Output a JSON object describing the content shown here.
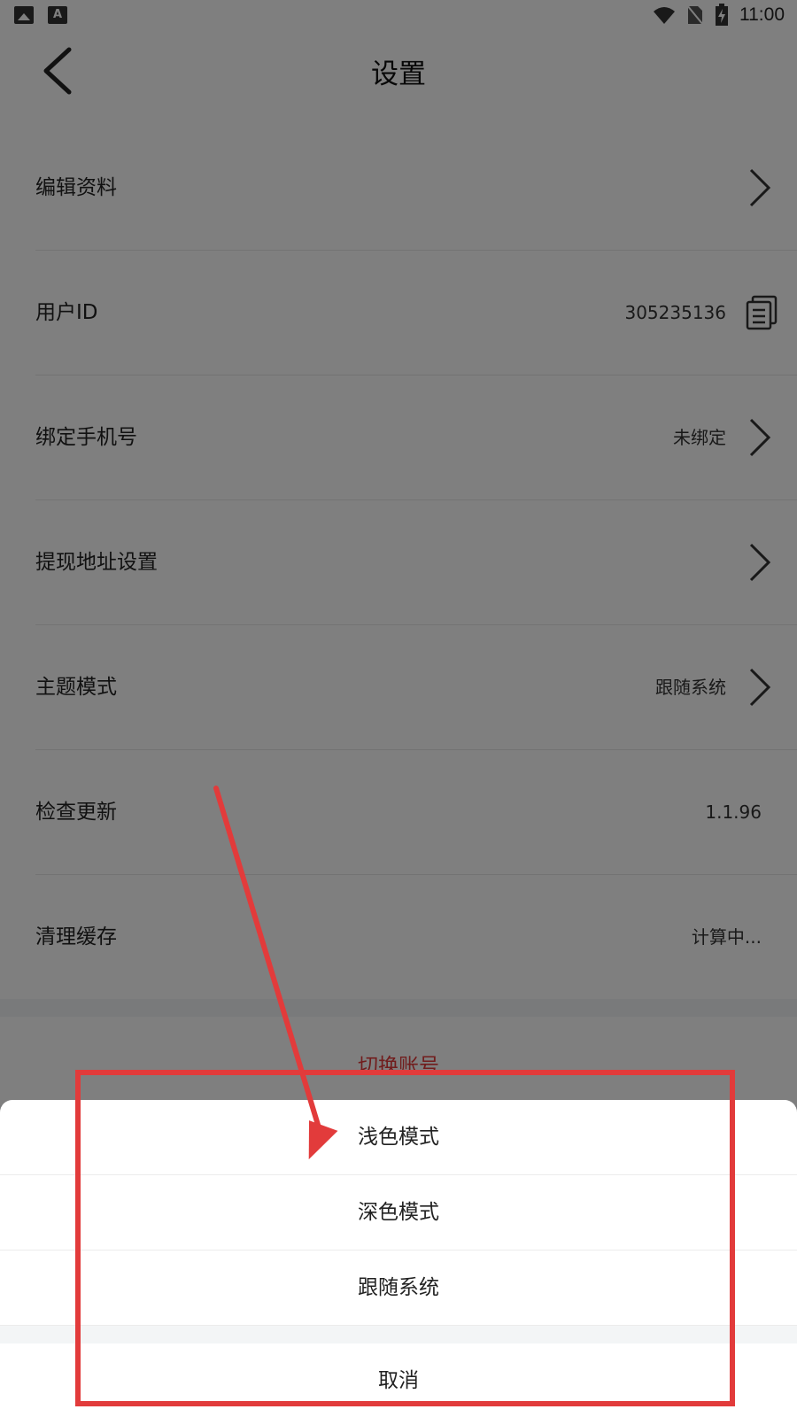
{
  "status_bar": {
    "time": "11:00",
    "left_icons": [
      "image-icon",
      "font-icon"
    ],
    "right_icons": [
      "wifi-icon",
      "no-sim-icon",
      "battery-charging-icon"
    ]
  },
  "header": {
    "title": "设置",
    "back_icon": "chevron-left-icon"
  },
  "settings": {
    "items": [
      {
        "label": "编辑资料",
        "value": "",
        "trailing": "chevron"
      },
      {
        "label": "用户ID",
        "value": "305235136",
        "trailing": "copy"
      },
      {
        "label": "绑定手机号",
        "value": "未绑定",
        "trailing": "chevron"
      },
      {
        "label": "提现地址设置",
        "value": "",
        "trailing": "chevron"
      },
      {
        "label": "主题模式",
        "value": "跟随系统",
        "trailing": "chevron"
      },
      {
        "label": "检查更新",
        "value": "1.1.96",
        "trailing": "none"
      },
      {
        "label": "清理缓存",
        "value": "计算中...",
        "trailing": "none"
      }
    ],
    "switch_account": "切换账号"
  },
  "theme_sheet": {
    "options": [
      "浅色模式",
      "深色模式",
      "跟随系统"
    ],
    "cancel": "取消"
  },
  "colors": {
    "accent_red": "#e23b3b",
    "overlay": "rgba(0,0,0,0.5)",
    "background": "#f3f5f6"
  }
}
